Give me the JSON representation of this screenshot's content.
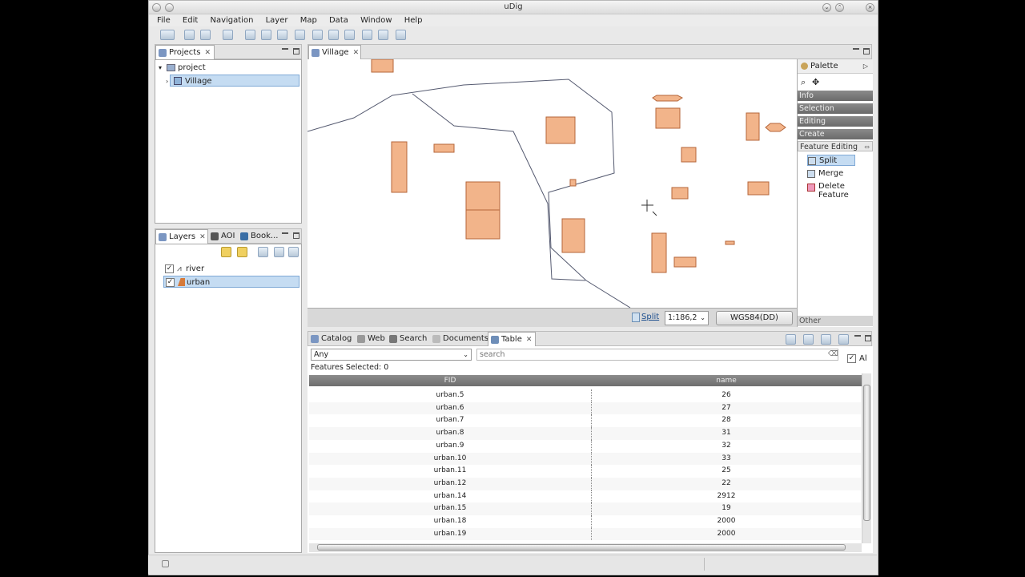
{
  "window": {
    "title": "uDig"
  },
  "menu": [
    "File",
    "Edit",
    "Navigation",
    "Layer",
    "Map",
    "Data",
    "Window",
    "Help"
  ],
  "projects_panel": {
    "tab": "Projects",
    "tree": [
      {
        "label": "project"
      },
      {
        "label": "Village"
      }
    ]
  },
  "layers_panel": {
    "tabs": [
      "Layers",
      "AOI",
      "Book..."
    ],
    "layers": [
      {
        "label": "river",
        "checked": true
      },
      {
        "label": "urban",
        "checked": true
      }
    ]
  },
  "map_editor": {
    "tab": "Village",
    "status": {
      "tool": "Split",
      "scale": "1:186,2",
      "crs": "WGS84(DD)"
    }
  },
  "palette": {
    "title": "Palette",
    "categories": [
      "Info",
      "Selection",
      "Editing",
      "Create",
      "Feature Editing"
    ],
    "items": [
      {
        "label": "Split"
      },
      {
        "label": "Merge"
      },
      {
        "label": "Delete Feature"
      }
    ],
    "other": "Other"
  },
  "bottom_tabs": [
    "Catalog",
    "Web",
    "Search",
    "Documents",
    "Table"
  ],
  "table_view": {
    "filter": "Any",
    "search_placeholder": "search",
    "all_label": "Al",
    "selected": "Features Selected: 0",
    "columns": [
      "FID",
      "name"
    ],
    "rows": [
      [
        "urban.5",
        "26"
      ],
      [
        "urban.6",
        "27"
      ],
      [
        "urban.7",
        "28"
      ],
      [
        "urban.8",
        "31"
      ],
      [
        "urban.9",
        "32"
      ],
      [
        "urban.10",
        "33"
      ],
      [
        "urban.11",
        "25"
      ],
      [
        "urban.12",
        "22"
      ],
      [
        "urban.14",
        "2912"
      ],
      [
        "urban.15",
        "19"
      ],
      [
        "urban.18",
        "2000"
      ],
      [
        "urban.19",
        "2000"
      ]
    ]
  },
  "colors": {
    "feature_fill": "#f2b48a",
    "feature_stroke": "#b5663a",
    "selection": "#c5dcf2"
  }
}
